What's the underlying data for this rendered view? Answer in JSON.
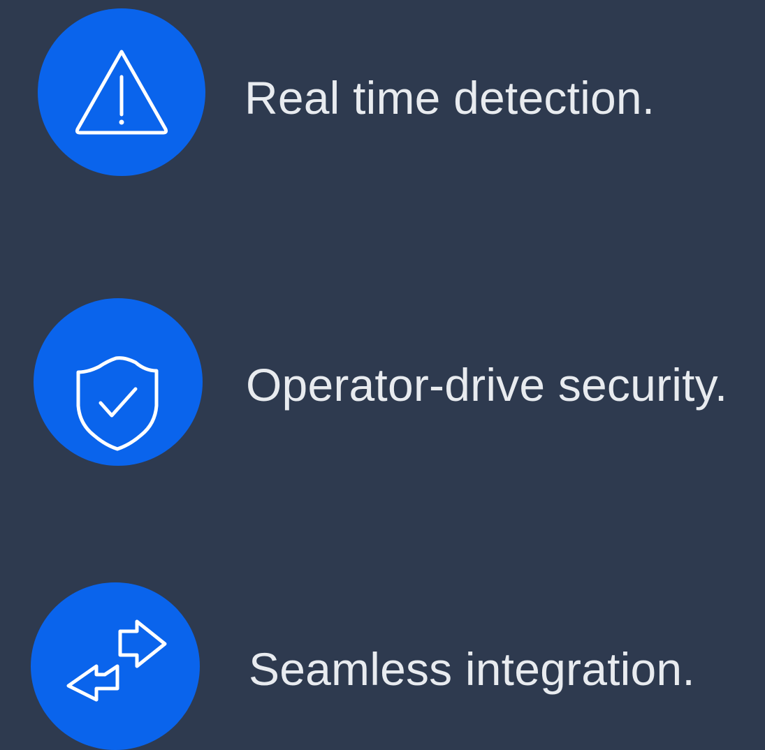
{
  "theme": {
    "background": "#2e3a4f",
    "accent": "#0a64ec",
    "text": "#e8ebef",
    "icon_stroke": "#ffffff"
  },
  "features": [
    {
      "icon": "warning-triangle-icon",
      "label": "Real time detection."
    },
    {
      "icon": "shield-check-icon",
      "label": "Operator-drive security."
    },
    {
      "icon": "swap-arrows-icon",
      "label": "Seamless integration."
    }
  ]
}
